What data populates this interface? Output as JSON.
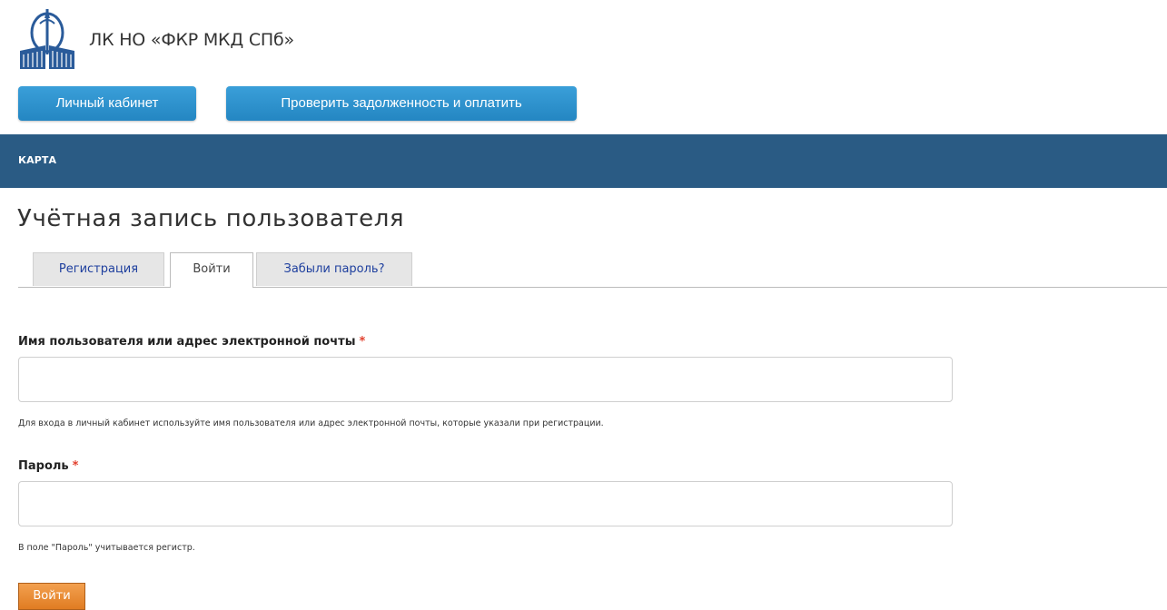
{
  "header": {
    "logo_icon": "spb-building-logo-icon",
    "site_name": "ЛК НО «ФКР МКД СПб»",
    "buttons": {
      "cabinet_label": "Личный кабинет",
      "pay_label": "Проверить задолженность и оплатить"
    },
    "colors": {
      "button_blue": "#2486c2"
    }
  },
  "nav": {
    "items": [
      {
        "label": "КАРТА"
      }
    ],
    "background": "#2a5b84"
  },
  "page": {
    "title": "Учётная запись пользователя"
  },
  "tabs": [
    {
      "label": "Регистрация",
      "active": false
    },
    {
      "label": "Войти",
      "active": true
    },
    {
      "label": "Забыли пароль?",
      "active": false
    }
  ],
  "form": {
    "username": {
      "label": "Имя пользователя или адрес электронной почты",
      "required_mark": "*",
      "value": "",
      "help": "Для входа в личный кабинет используйте имя пользователя или адрес электронной почты, которые указали при регистрации."
    },
    "password": {
      "label": "Пароль",
      "required_mark": "*",
      "value": "",
      "help": "В поле \"Пароль\" учитывается регистр."
    },
    "submit_label": "Войти",
    "submit_color": "#e07c22"
  }
}
